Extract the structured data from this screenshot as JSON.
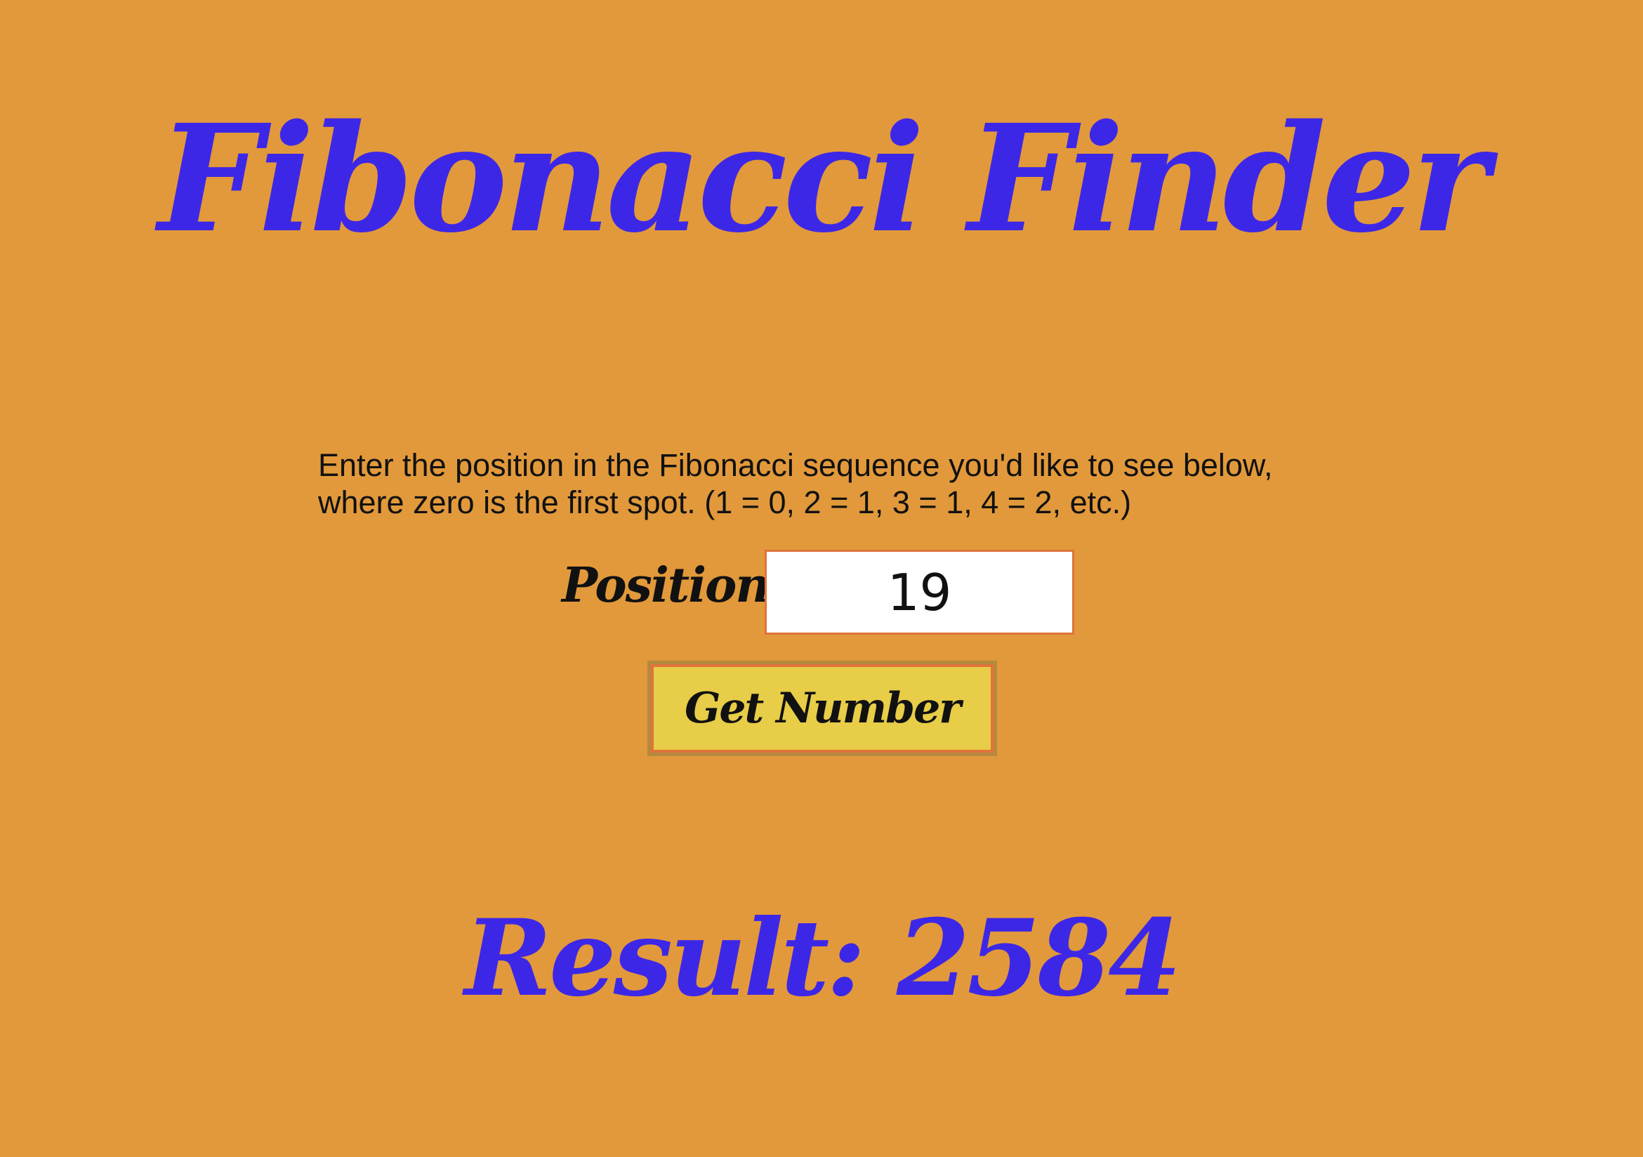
{
  "app": {
    "title": "Fibonacci Finder"
  },
  "instructions": {
    "line1": "Enter the position in the Fibonacci sequence you'd like to see below,",
    "line2": "where zero is the first spot. (1 = 0, 2 = 1, 3 = 1, 4 = 2, etc.)"
  },
  "form": {
    "position_label": "Position:",
    "position_value": "19",
    "button_label": "Get Number"
  },
  "result": {
    "text": "Result: 2584"
  },
  "colors": {
    "background": "#E2993B",
    "accent": "#3D27E6",
    "button": "#E7CD48",
    "input_border": "#E0733A"
  }
}
